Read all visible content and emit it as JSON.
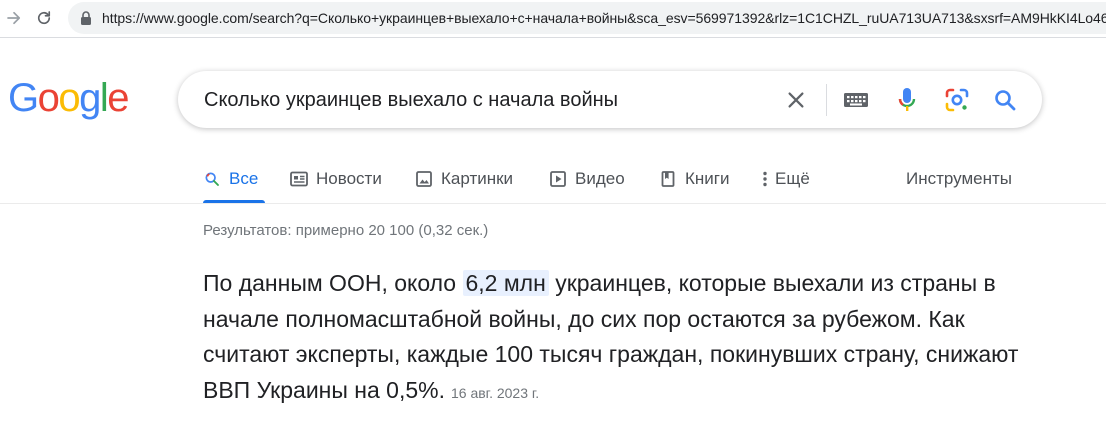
{
  "browser": {
    "url": "https://www.google.com/search?q=Сколько+украинцев+выехало+с+начала+войны&sca_esv=569971392&rlz=1C1CHZL_ruUA713UA713&sxsrf=AM9HkKI4Lo46"
  },
  "logo": {
    "letters": [
      "G",
      "o",
      "o",
      "g",
      "l",
      "e"
    ],
    "colors": [
      "#4285F4",
      "#EA4335",
      "#FBBC05",
      "#4285F4",
      "#34A853",
      "#EA4335"
    ]
  },
  "search": {
    "query": "Сколько украинцев выехало с начала войны",
    "icons": [
      "close-icon",
      "keyboard-icon",
      "microphone-icon",
      "lens-icon",
      "search-icon"
    ]
  },
  "tabs": [
    {
      "label": "Все",
      "icon": "search-icon",
      "active": true
    },
    {
      "label": "Новости",
      "icon": "news-icon",
      "active": false
    },
    {
      "label": "Картинки",
      "icon": "image-icon",
      "active": false
    },
    {
      "label": "Видео",
      "icon": "video-icon",
      "active": false
    },
    {
      "label": "Книги",
      "icon": "book-icon",
      "active": false
    },
    {
      "label": "Ещё",
      "icon": "more-vert-icon",
      "active": false
    }
  ],
  "tools_label": "Инструменты",
  "result_stats": "Результатов: примерно 20 100 (0,32 сек.)",
  "snippet": {
    "before": "По данным ООН, около ",
    "highlight": "6,2 млн",
    "after": " украинцев, которые выехали из страны в начале полномасштабной войны, до сих пор остаются за рубежом. Как считают эксперты, каждые 100 тысяч граждан, покинувших страну, снижают ВВП Украины на 0,5%.",
    "date": "16 авг. 2023 г."
  },
  "colors": {
    "accent": "#1a73e8",
    "text": "#202124",
    "secondary": "#70757a",
    "highlight_bg": "#e8f0fe"
  }
}
